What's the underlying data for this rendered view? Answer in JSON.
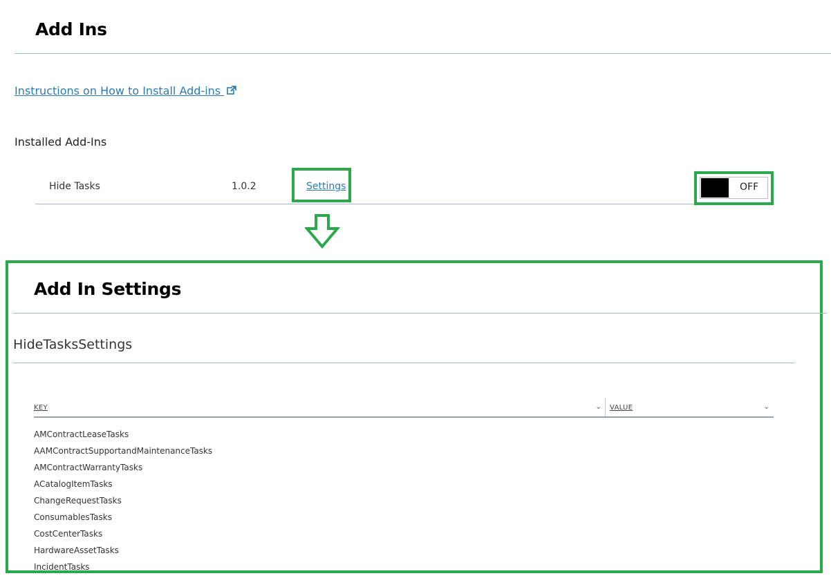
{
  "page": {
    "title": "Add Ins",
    "instructions_link": "Instructions on How to Install Add-ins",
    "installed_label": "Installed Add-Ins"
  },
  "addins": [
    {
      "name": "Hide Tasks",
      "version": "1.0.2",
      "settings_label": "Settings",
      "toggle_label": "OFF"
    }
  ],
  "settings": {
    "title": "Add In Settings",
    "section_title": "HideTasksSettings",
    "columns": {
      "key": "KEY",
      "value": "VALUE"
    },
    "rows": [
      "AMContractLeaseTasks",
      "AAMContractSupportandMaintenanceTasks",
      "AMContractWarrantyTasks",
      "ACatalogItemTasks",
      "ChangeRequestTasks",
      "ConsumablesTasks",
      "CostCenterTasks",
      "HardwareAssetTasks",
      "IncidentTasks"
    ]
  },
  "colors": {
    "accent_highlight": "#2aa84a",
    "link": "#2c7bb0",
    "divider": "#9fbcc2"
  },
  "icons": [
    "external-link-icon",
    "down-arrow-icon",
    "chevron-down-icon"
  ]
}
